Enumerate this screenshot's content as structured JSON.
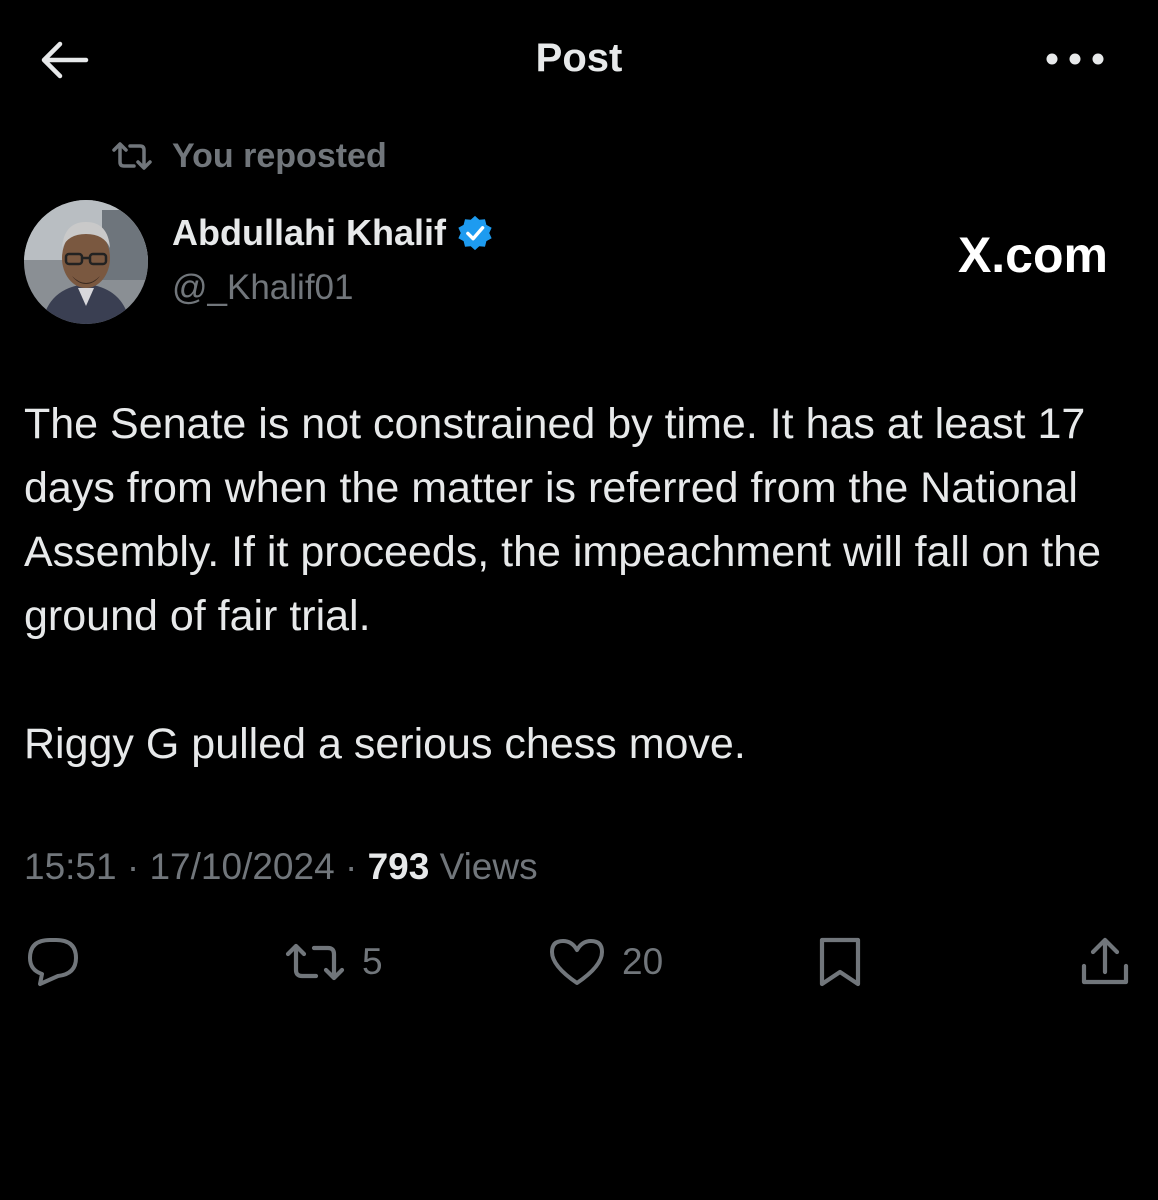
{
  "header": {
    "title": "Post",
    "back_icon": "arrow-left-icon",
    "more_icon": "ellipsis-icon"
  },
  "repost_banner": {
    "text": "You reposted",
    "icon": "repost-icon"
  },
  "author": {
    "name": "Abdullahi Khalif",
    "handle": "@_Khalif01",
    "verified": true,
    "verified_color": "#1d9bf0"
  },
  "watermark": "X.com",
  "tweet": {
    "paragraphs": [
      "The Senate is not constrained by time. It has at least 17 days from when the matter is referred from the National Assembly. If it proceeds, the impeachment will fall on the ground of fair trial.",
      "Riggy G pulled a serious chess move."
    ],
    "time": "15:51",
    "date": "17/10/2024",
    "views_count": "793",
    "views_label": "Views"
  },
  "actions": {
    "reply_count": "",
    "repost_count": "5",
    "like_count": "20"
  },
  "colors": {
    "background": "#000000",
    "text_primary": "#e7e9ea",
    "text_secondary": "#71767b"
  }
}
